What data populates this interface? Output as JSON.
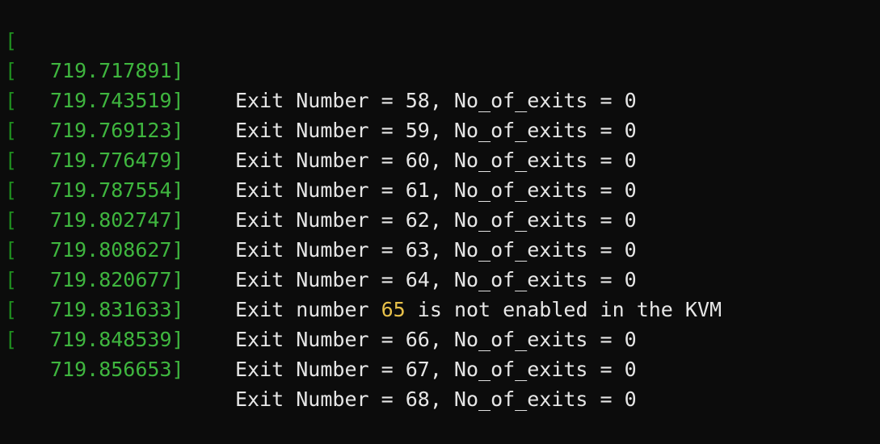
{
  "terminal": {
    "lines": [
      {
        "bracket": "[",
        "timestamp": "719.717891]",
        "message": "Exit Number = 58, No_of_exits = 0"
      },
      {
        "bracket": "[",
        "timestamp": "719.743519]",
        "message": "Exit Number = 59, No_of_exits = 0"
      },
      {
        "bracket": "[",
        "timestamp": "719.769123]",
        "message": "Exit Number = 60, No_of_exits = 0"
      },
      {
        "bracket": "[",
        "timestamp": "719.776479]",
        "message": "Exit Number = 61, No_of_exits = 0"
      },
      {
        "bracket": "[",
        "timestamp": "719.787554]",
        "message": "Exit Number = 62, No_of_exits = 0"
      },
      {
        "bracket": "[",
        "timestamp": "719.802747]",
        "message": "Exit Number = 63, No_of_exits = 0"
      },
      {
        "bracket": "[",
        "timestamp": "719.808627]",
        "message": "Exit Number = 64, No_of_exits = 0"
      },
      {
        "bracket": "[",
        "timestamp": "719.820677]",
        "message_prefix": "Exit number ",
        "message_number": "65",
        "message_suffix": " is not enabled in the KVM"
      },
      {
        "bracket": "[",
        "timestamp": "719.831633]",
        "message": "Exit Number = 66, No_of_exits = 0"
      },
      {
        "bracket": "[",
        "timestamp": "719.848539]",
        "message": "Exit Number = 67, No_of_exits = 0"
      },
      {
        "bracket": "[",
        "timestamp": "719.856653]",
        "message": "Exit Number = 68, No_of_exits = 0"
      }
    ]
  }
}
